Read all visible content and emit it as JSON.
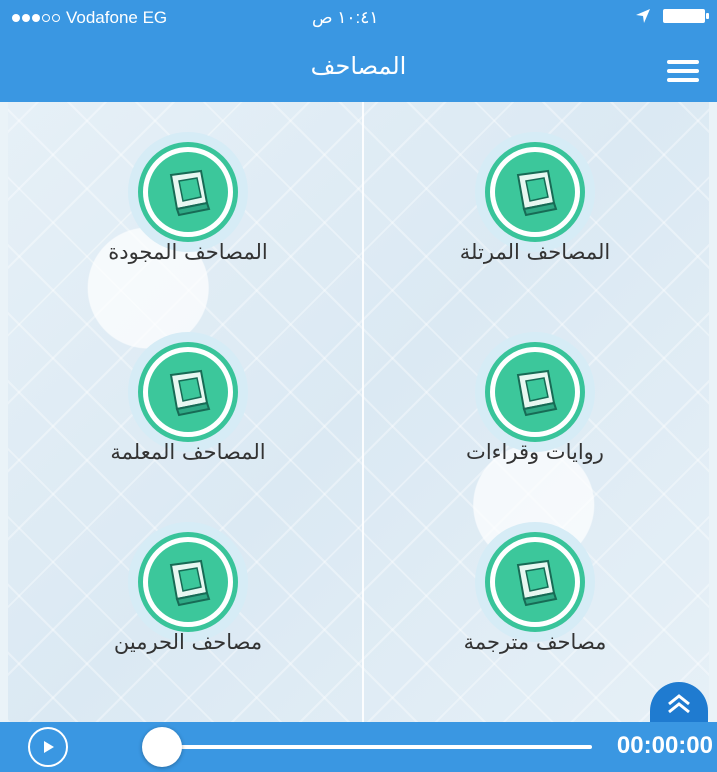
{
  "status": {
    "carrier": "Vodafone EG",
    "time": "١٠:٤١ ص"
  },
  "header": {
    "title": "المصاحف"
  },
  "tiles": [
    {
      "label": "المصاحف المرتلة"
    },
    {
      "label": "المصاحف المجودة"
    },
    {
      "label": "روايات وقراءات"
    },
    {
      "label": "المصاحف المعلمة"
    },
    {
      "label": "مصاحف مترجمة"
    },
    {
      "label": "مصاحف الحرمين"
    }
  ],
  "player": {
    "time": "00:00:00",
    "progress": 0
  },
  "colors": {
    "primary": "#3a97e2",
    "accent": "#3cc79b"
  },
  "icons": {
    "menu": "hamburger-icon",
    "location": "location-arrow-icon",
    "book": "mushaf-book-icon",
    "scroll_up": "double-chevron-up-icon",
    "play": "play-icon"
  }
}
